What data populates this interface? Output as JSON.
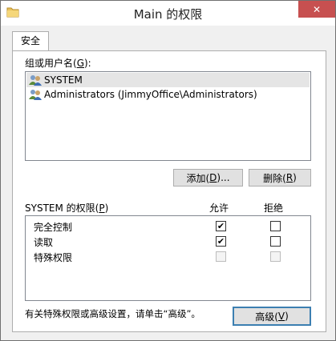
{
  "window": {
    "title": "Main 的权限",
    "close_glyph": "✕"
  },
  "tabs": [
    {
      "label": "安全"
    }
  ],
  "groups": {
    "label_prefix": "组或用户名(",
    "label_key": "G",
    "label_suffix": "):",
    "items": [
      {
        "name": "SYSTEM",
        "icon": "user-group-icon",
        "selected": true
      },
      {
        "name": "Administrators (JimmyOffice\\Administrators)",
        "icon": "user-group-icon",
        "selected": false
      }
    ]
  },
  "buttons": {
    "add_prefix": "添加(",
    "add_key": "D",
    "add_suffix": ")...",
    "remove_prefix": "删除(",
    "remove_key": "R",
    "remove_suffix": ")",
    "advanced_prefix": "高级(",
    "advanced_key": "V",
    "advanced_suffix": ")"
  },
  "permissions": {
    "label_prefix": "SYSTEM 的权限(",
    "label_key": "P",
    "label_suffix": ")",
    "allow_header": "允许",
    "deny_header": "拒绝",
    "rows": [
      {
        "name": "完全控制",
        "allow": "checked",
        "deny": "unchecked"
      },
      {
        "name": "读取",
        "allow": "checked",
        "deny": "unchecked"
      },
      {
        "name": "特殊权限",
        "allow": "disabled",
        "deny": "disabled"
      }
    ]
  },
  "footer_note": "有关特殊权限或高级设置，请单击“高级”。"
}
